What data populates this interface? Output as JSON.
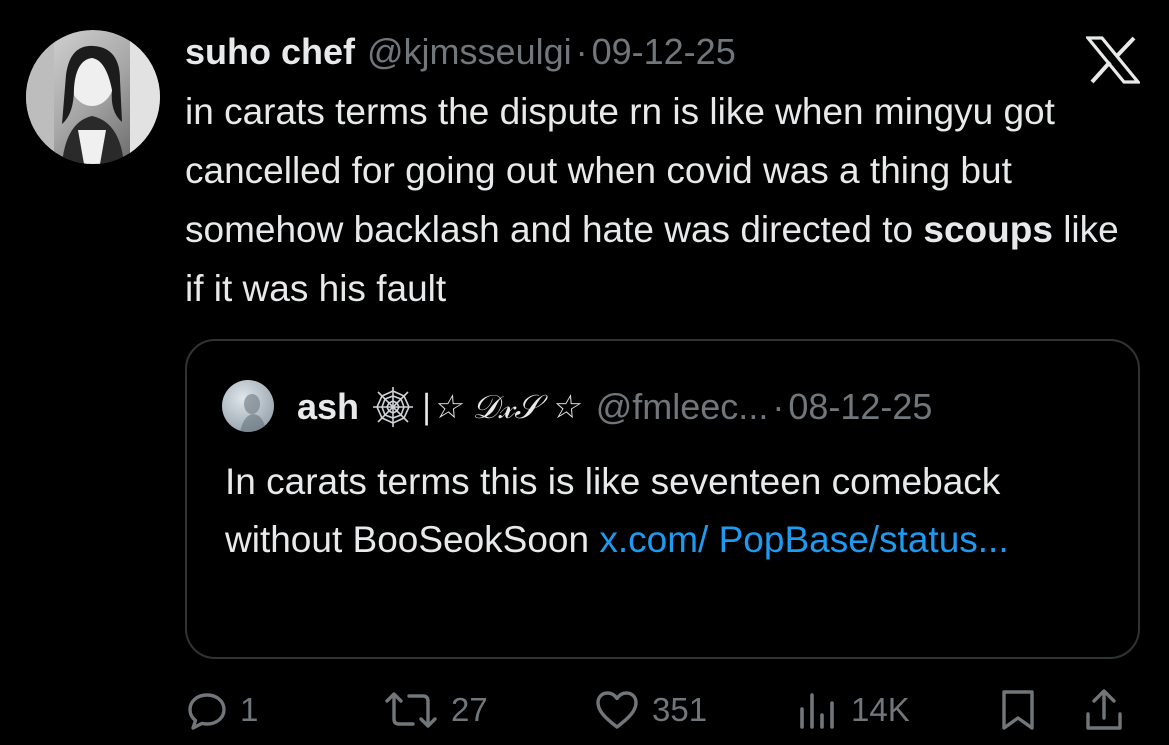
{
  "tweet": {
    "display_name": "suho chef",
    "handle": "@kjmsseulgi",
    "separator": "·",
    "date": "09-12-25",
    "text_parts": [
      "in carats terms the dispute rn is like when mingyu got cancelled for going out when covid was a thing but somehow backlash and hate was directed to ",
      "scoups",
      " like if it was his fault"
    ]
  },
  "quote": {
    "display_name": "ash",
    "decoration": "|☆ 𝒟𝓍𝒮 ☆",
    "handle": "@fmleec...",
    "separator": "·",
    "date": "08-12-25",
    "text": "In carats terms this is like seventeen comeback without BooSeokSoon ",
    "link_text": "x.com/ PopBase/status..."
  },
  "actions": {
    "reply_count": "1",
    "retweet_count": "27",
    "like_count": "351",
    "views_count": "14K"
  },
  "icons": {
    "logo": "x-logo-icon",
    "reply": "reply-icon",
    "retweet": "retweet-icon",
    "like": "heart-icon",
    "views": "views-icon",
    "bookmark": "bookmark-icon",
    "share": "share-icon",
    "badge": "spiderweb-icon"
  },
  "colors": {
    "background": "#000000",
    "text": "#e7e9ea",
    "muted": "#71767b",
    "link": "#1d9bf0",
    "border": "#2f3336"
  }
}
